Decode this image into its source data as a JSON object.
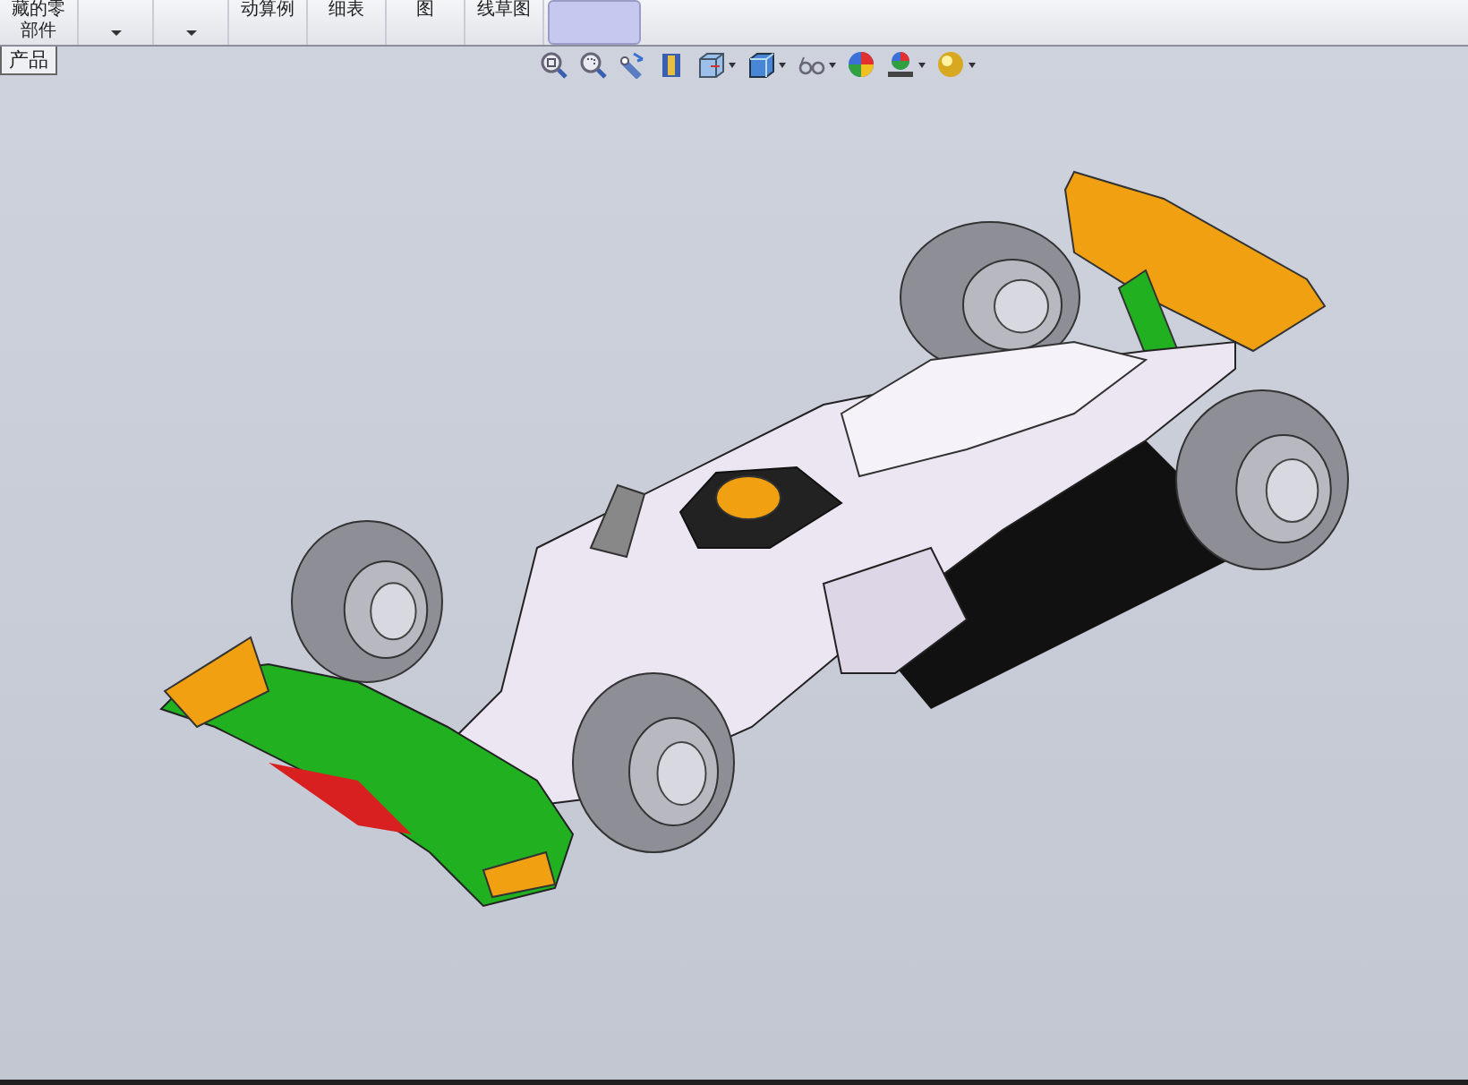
{
  "ribbon": {
    "items": [
      {
        "kind": "label",
        "lines": [
          "藏的零",
          "部件"
        ],
        "selected": false
      },
      {
        "kind": "dropdown",
        "selected": false
      },
      {
        "kind": "dropdown",
        "selected": false
      },
      {
        "kind": "label",
        "lines": [
          "动算例"
        ],
        "selected": false
      },
      {
        "kind": "label",
        "lines": [
          "细表"
        ],
        "selected": false
      },
      {
        "kind": "label",
        "lines": [
          "图"
        ],
        "selected": false
      },
      {
        "kind": "label",
        "lines": [
          "线草图"
        ],
        "selected": false
      },
      {
        "kind": "blank",
        "selected": true
      }
    ]
  },
  "feature_tab": {
    "label": "产品"
  },
  "view_toolbar": {
    "tools": [
      {
        "kind": "zoom-fit",
        "dropdown": false
      },
      {
        "kind": "zoom-area",
        "dropdown": false
      },
      {
        "kind": "previous-view",
        "dropdown": false
      },
      {
        "kind": "section",
        "dropdown": false
      },
      {
        "kind": "orientation",
        "dropdown": true
      },
      {
        "kind": "display-style",
        "dropdown": true
      },
      {
        "kind": "hide-show",
        "dropdown": true
      },
      {
        "kind": "appearance",
        "dropdown": false
      },
      {
        "kind": "scene",
        "dropdown": true
      },
      {
        "kind": "view-settings",
        "dropdown": true
      }
    ]
  }
}
